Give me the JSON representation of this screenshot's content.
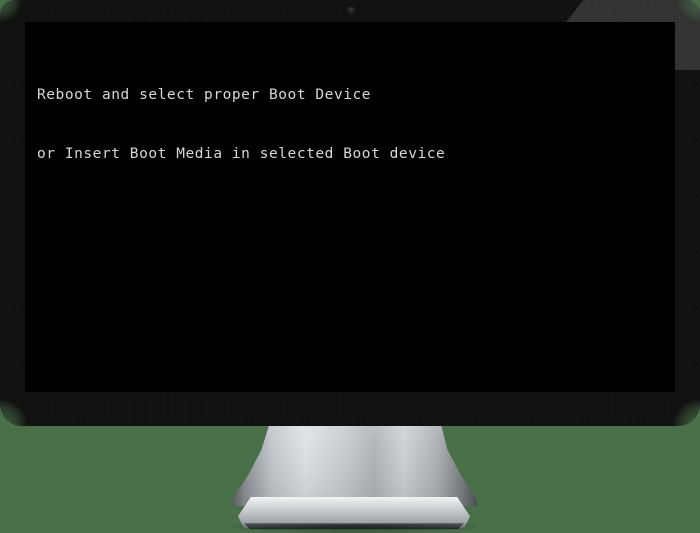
{
  "background": {
    "color": "#4a704a"
  },
  "monitor": {
    "bezel_color": "#111111",
    "bezel_highlight_color": "#333333",
    "webcam_icon": "webcam-dot-icon"
  },
  "screen": {
    "background_color": "#000000",
    "text_color": "#d8d8d8",
    "bios_message": {
      "line1": "Reboot and select proper Boot Device",
      "line2": "or Insert Boot Media in selected Boot device"
    }
  },
  "stand": {
    "neck_color": "#c9cdd1",
    "base_color": "#c8ccd0"
  }
}
